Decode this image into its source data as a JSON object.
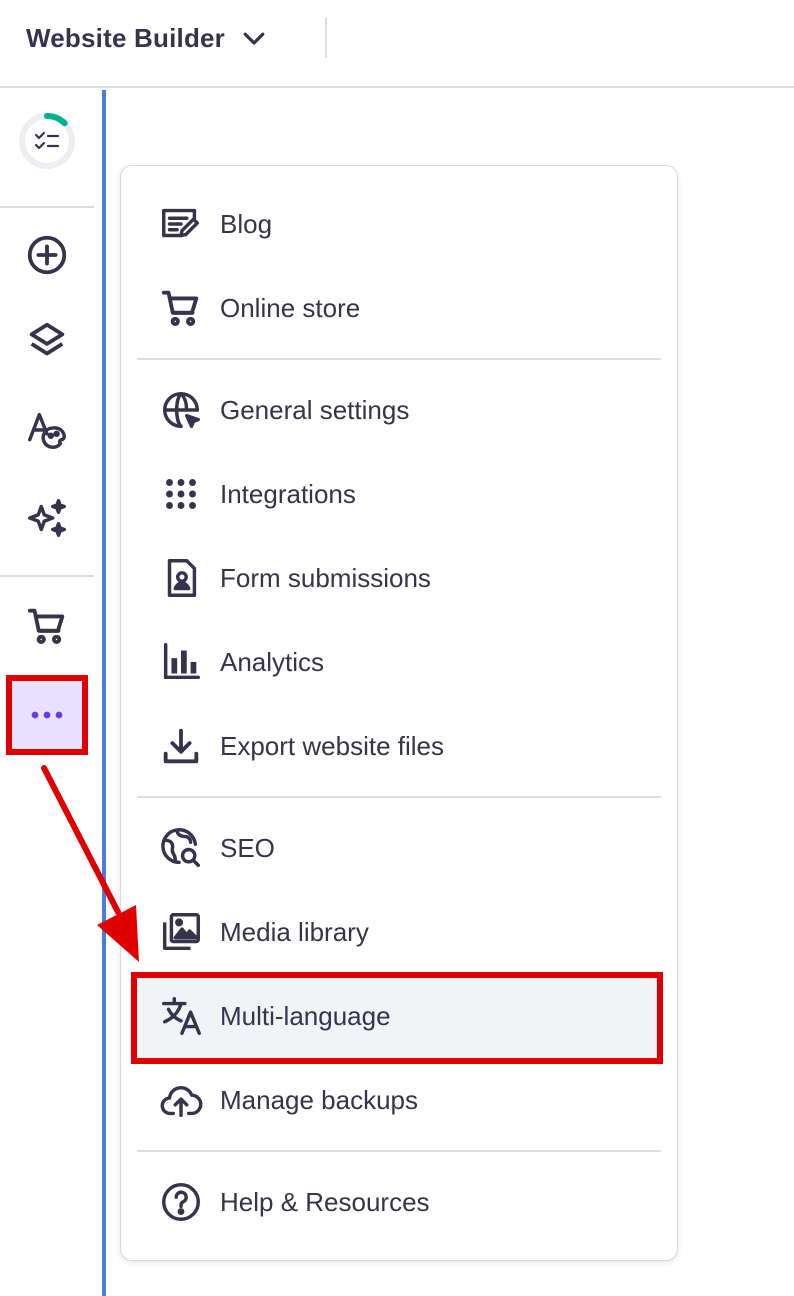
{
  "topbar": {
    "title": "Website Builder"
  },
  "sidebar": {
    "items": [
      "progress-checklist-icon",
      "add-element-icon",
      "layers-icon",
      "styles-icon",
      "ai-sparkles-icon",
      "store-cart-icon",
      "more-icon"
    ]
  },
  "menu": {
    "groups": [
      [
        {
          "label": "Blog",
          "icon": "blog-edit-icon"
        },
        {
          "label": "Online store",
          "icon": "cart-icon"
        }
      ],
      [
        {
          "label": "General settings",
          "icon": "globe-cursor-icon"
        },
        {
          "label": "Integrations",
          "icon": "grid-dots-icon"
        },
        {
          "label": "Form submissions",
          "icon": "form-person-icon"
        },
        {
          "label": "Analytics",
          "icon": "bar-chart-icon"
        },
        {
          "label": "Export website files",
          "icon": "download-icon"
        }
      ],
      [
        {
          "label": "SEO",
          "icon": "globe-search-icon"
        },
        {
          "label": "Media library",
          "icon": "images-icon"
        },
        {
          "label": "Multi-language",
          "icon": "translate-icon"
        },
        {
          "label": "Manage backups",
          "icon": "cloud-upload-icon"
        }
      ],
      [
        {
          "label": "Help & Resources",
          "icon": "help-circle-icon"
        }
      ]
    ]
  },
  "colors": {
    "accent": "#673de6",
    "highlight": "#e00000",
    "progress": "#00b090",
    "divider": "#4a7ce0"
  }
}
